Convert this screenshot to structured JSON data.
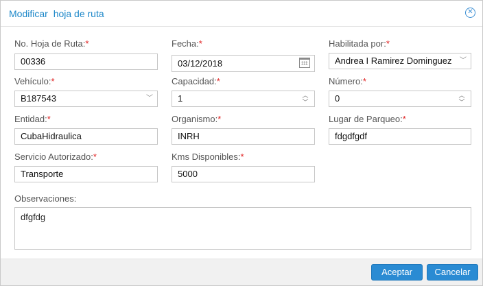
{
  "dialog": {
    "title_part1": "Modificar",
    "title_part2": "hoja de ruta",
    "close_icon": "close-icon"
  },
  "fields": {
    "hoja": {
      "label": "No. Hoja de Ruta:",
      "value": "00336"
    },
    "fecha": {
      "label": "Fecha:",
      "value": "03/12/2018"
    },
    "habilitada": {
      "label": "Habilitada por:",
      "value": "Andrea I Ramirez Dominguez"
    },
    "vehiculo": {
      "label": "Vehículo:",
      "value": "B187543"
    },
    "capacidad": {
      "label": "Capacidad:",
      "value": "1"
    },
    "numero": {
      "label": "Número:",
      "value": "0"
    },
    "entidad": {
      "label": "Entidad:",
      "value": "CubaHidraulica"
    },
    "organismo": {
      "label": "Organismo:",
      "value": "INRH"
    },
    "parqueo": {
      "label": "Lugar de Parqueo:",
      "value": "fdgdfgdf"
    },
    "servicio": {
      "label": "Servicio Autorizado:",
      "value": "Transporte"
    },
    "kms": {
      "label": "Kms Disponibles:",
      "value": "5000"
    },
    "observaciones": {
      "label": "Observaciones:",
      "value": "dfgfdg"
    }
  },
  "required_mark": "*",
  "buttons": {
    "accept": "Aceptar",
    "cancel": "Cancelar"
  },
  "colors": {
    "accent": "#1a86c8",
    "button": "#2a8bd3",
    "required": "#e02020"
  }
}
